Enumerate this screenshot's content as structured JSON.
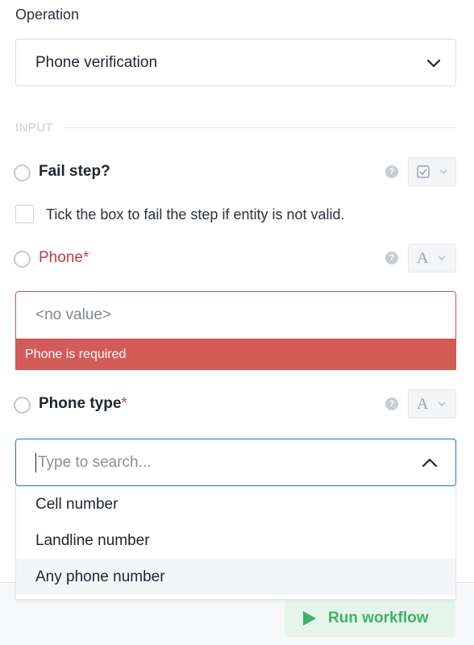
{
  "operation": {
    "label": "Operation",
    "value": "Phone verification",
    "icon": "chevron-down-icon"
  },
  "input_section": {
    "label": "INPUT"
  },
  "fields": {
    "fail_step": {
      "label": "Fail step?",
      "type_icon": "checkbox-icon",
      "checkbox_label": "Tick the box to fail the step if entity is not valid.",
      "checked": false
    },
    "phone": {
      "label": "Phone",
      "required_marker": "*",
      "type_glyph": "A",
      "value_placeholder": "<no value>",
      "error": "Phone is required"
    },
    "phone_type": {
      "label": "Phone type",
      "required_marker": "*",
      "type_glyph": "A",
      "search_placeholder": "Type to search...",
      "options": [
        "Cell number",
        "Landline number",
        "Any phone number"
      ],
      "hovered_option": "Any phone number"
    }
  },
  "footer": {
    "run_label": "Run workflow",
    "run_icon": "play-icon"
  },
  "colors": {
    "error": "#d35b58",
    "focus": "#1e6fd9",
    "success": "#3fb26a",
    "success_bg": "#e6f5ec"
  }
}
